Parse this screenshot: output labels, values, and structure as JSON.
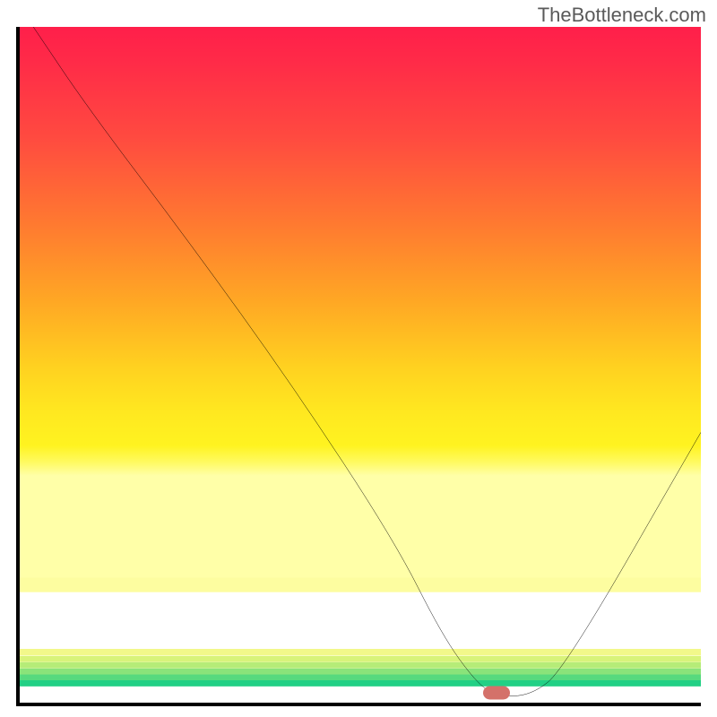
{
  "watermark": "TheBottleneck.com",
  "chart_data": {
    "type": "line",
    "title": "",
    "xlabel": "",
    "ylabel": "",
    "xlim": [
      0,
      100
    ],
    "ylim": [
      0,
      100
    ],
    "curve": {
      "x": [
        2,
        10,
        25,
        40,
        55,
        62,
        67,
        70,
        75,
        80,
        100
      ],
      "y": [
        100,
        88,
        68,
        47,
        24,
        10,
        3,
        1,
        1,
        5,
        40
      ]
    },
    "marker": {
      "x": 70,
      "y": 1.5
    },
    "background": {
      "description": "vertical gradient backdrop, red at top through orange/yellow to green at bottom",
      "stops": [
        {
          "pos": 0.0,
          "color": "#ff1f4a"
        },
        {
          "pos": 0.36,
          "color": "#ff7a30"
        },
        {
          "pos": 0.62,
          "color": "#ffd220"
        },
        {
          "pos": 0.82,
          "color": "#fdfda0"
        },
        {
          "pos": 0.97,
          "color": "#22d085"
        }
      ]
    }
  }
}
